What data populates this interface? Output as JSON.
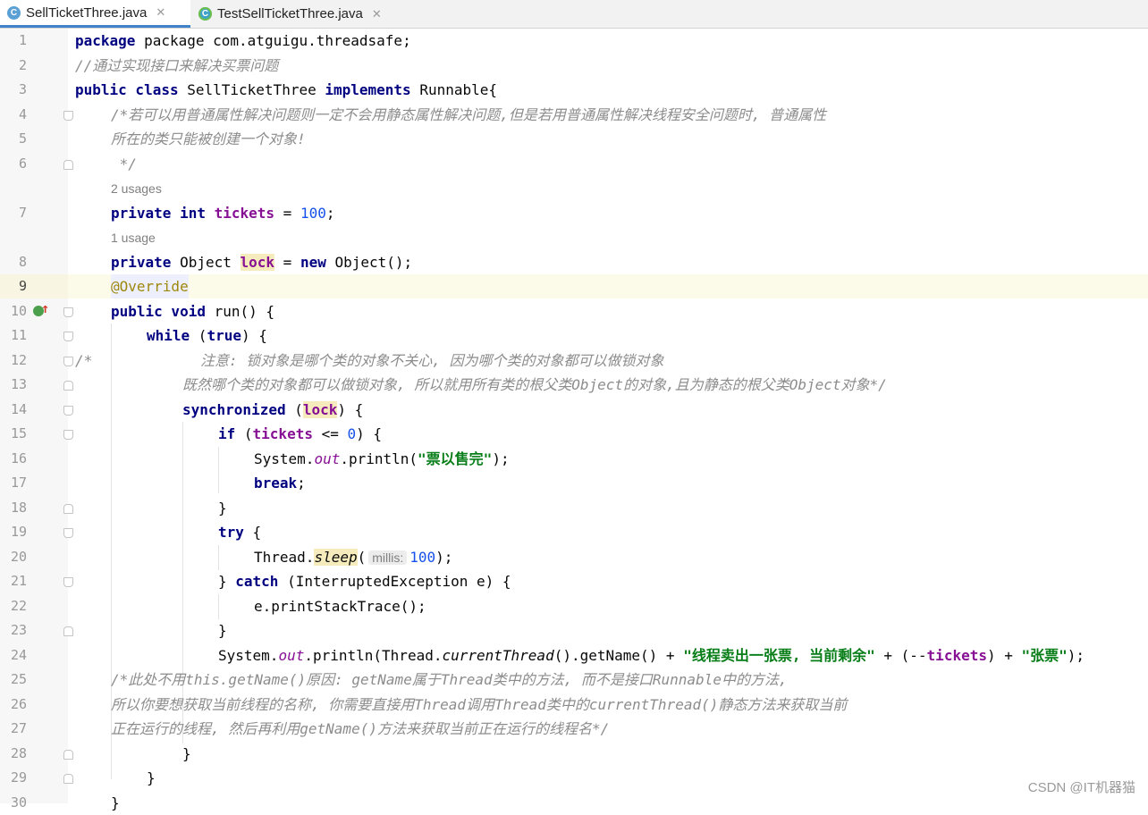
{
  "tabs": [
    {
      "label": "SellTicketThree.java",
      "icon": "java-class-icon",
      "active": true
    },
    {
      "label": "TestSellTicketThree.java",
      "icon": "java-test-class-icon",
      "active": false
    }
  ],
  "close_glyph": "✕",
  "watermark": "CSDN @IT机器猫",
  "hints": {
    "usages_2": "2 usages",
    "usage_1": "1 usage",
    "param_millis": "millis:"
  },
  "lines": {
    "1": "package com.atguigu.threadsafe;",
    "2": "//通过实现接口来解决买票问题",
    "4": "/*若可以用普通属性解决问题则一定不会用静态属性解决问题,但是若用普通属性解决线程安全问题时, 普通属性",
    "5": "所在的类只能被创建一个对象!",
    "6": " */",
    "12a": "/*",
    "12b": "注意: 锁对象是哪个类的对象不关心, 因为哪个类的对象都可以做锁对象",
    "13": "既然哪个类的对象都可以做锁对象, 所以就用所有类的根父类Object的对象,且为静态的根父类Object对象*/",
    "25": "/*此处不用this.getName()原因: getName属于Thread类中的方法, 而不是接口Runnable中的方法,",
    "26": "所以你要想获取当前线程的名称, 你需要直接用Thread调用Thread类中的currentThread()静态方法来获取当前",
    "27": "正在运行的线程, 然后再利用getName()方法来获取当前正在运行的线程名*/"
  },
  "strings": {
    "sold_out": "\"票以售完\"",
    "sell_one": "\"线程卖出一张票, 当前剩余\"",
    "zhang": "\"张票\""
  },
  "line_numbers": [
    "1",
    "2",
    "3",
    "4",
    "5",
    "6",
    "7",
    "8",
    "9",
    "10",
    "11",
    "12",
    "13",
    "14",
    "15",
    "16",
    "17",
    "18",
    "19",
    "20",
    "21",
    "22",
    "23",
    "24",
    "25",
    "26",
    "27",
    "28",
    "29",
    "30"
  ]
}
